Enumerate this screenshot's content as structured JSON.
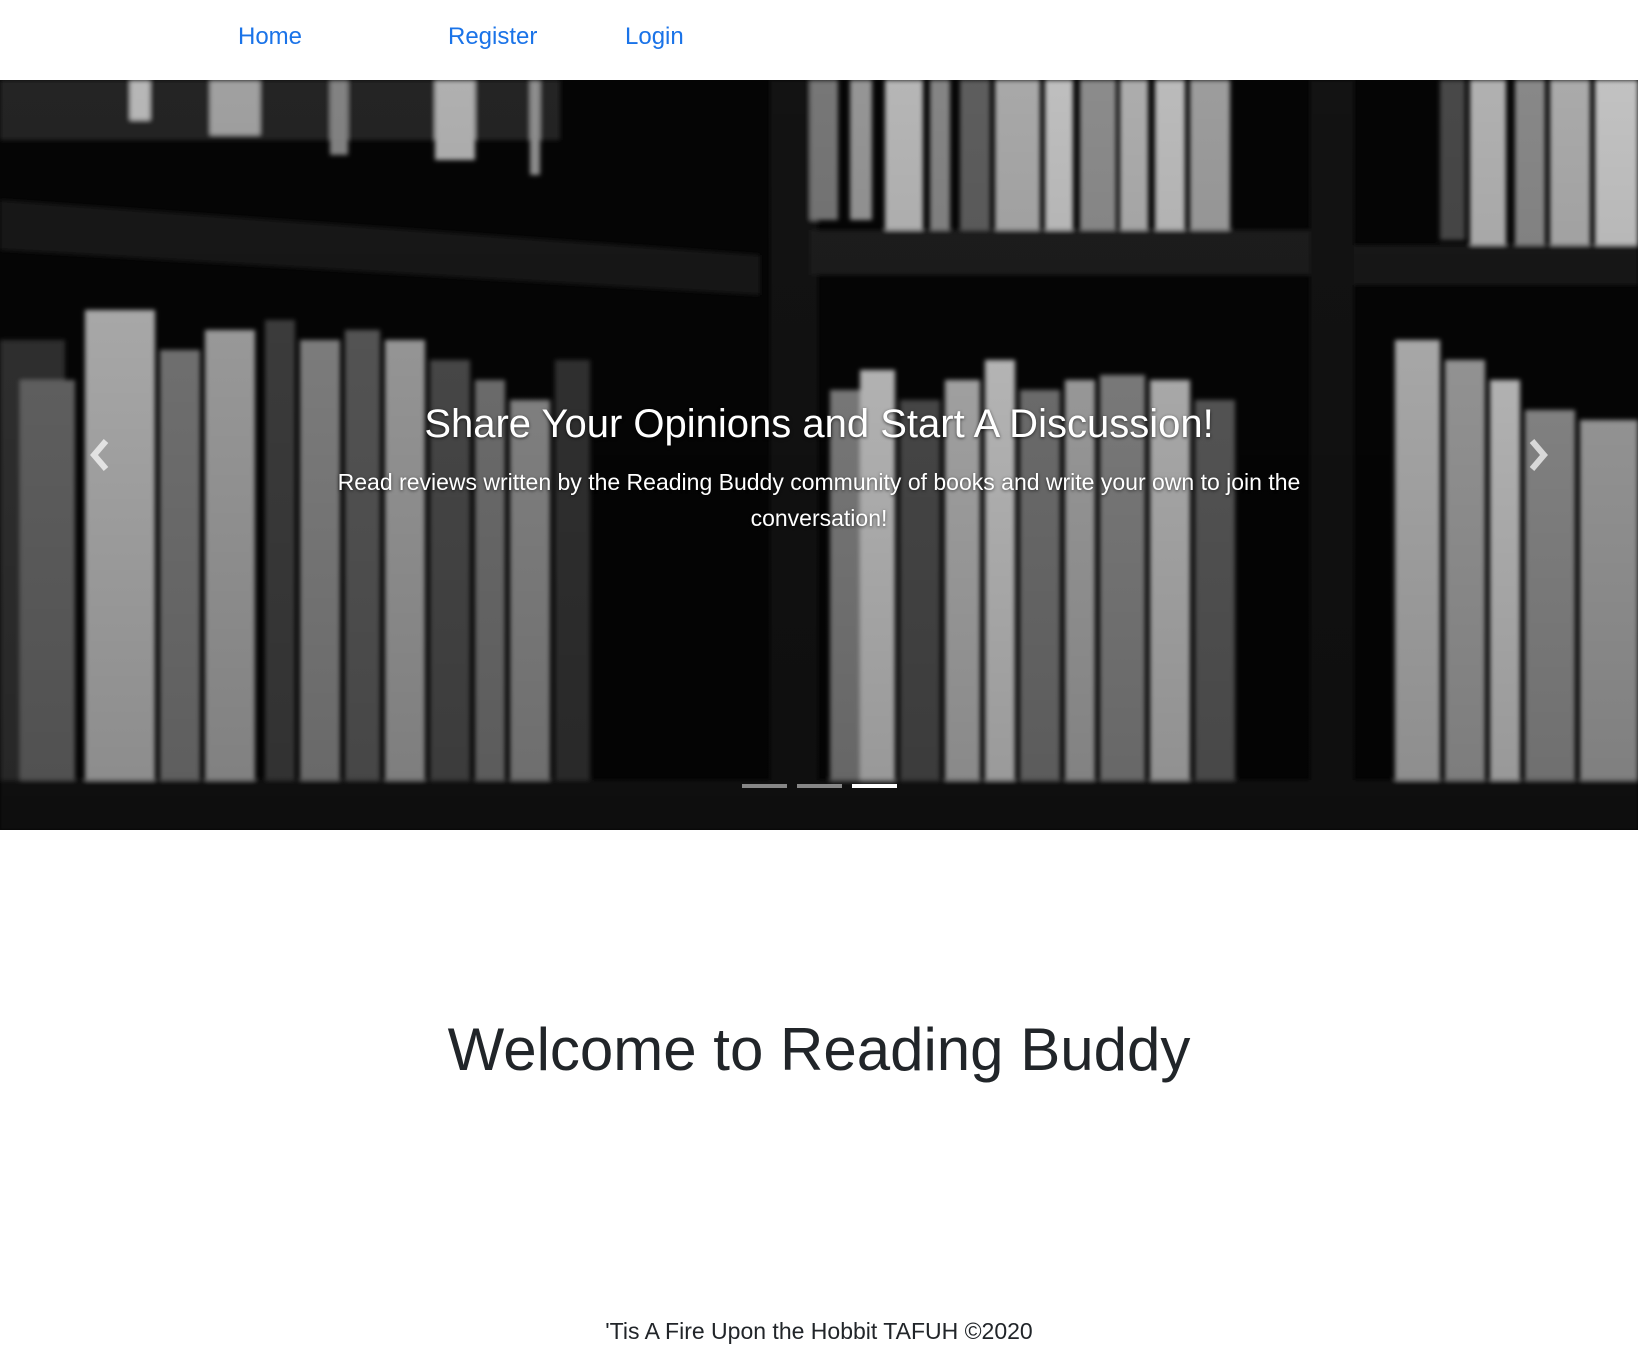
{
  "nav": {
    "home": "Home",
    "register": "Register",
    "login": "Login",
    "link_color": "#1a73e8"
  },
  "carousel": {
    "title": "Share Your Opinions and Start A Discussion!",
    "text": "Read reviews written by the Reading Buddy community of books and write your own to join the conversation!",
    "indicator_count": 3,
    "active_index": 2,
    "prev_icon": "chevron-left-icon",
    "next_icon": "chevron-right-icon"
  },
  "main": {
    "heading": "Welcome to Reading Buddy"
  },
  "footer": {
    "text": "'Tis A Fire Upon the Hobbit TAFUH ©2020"
  }
}
